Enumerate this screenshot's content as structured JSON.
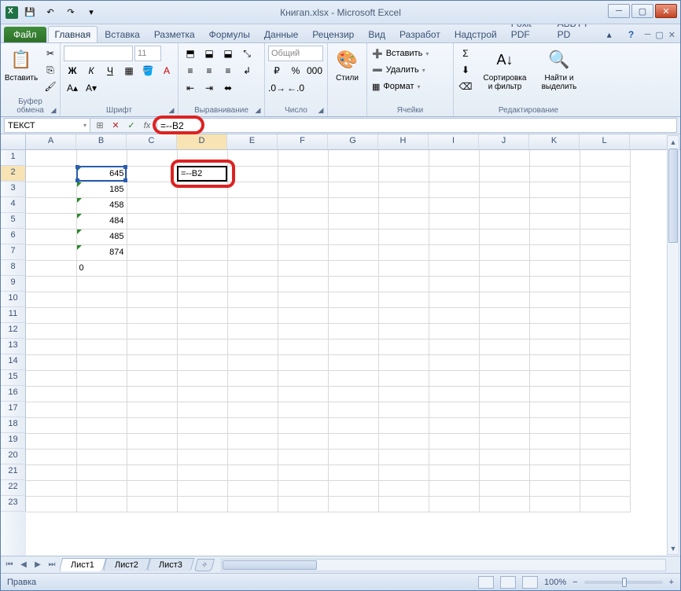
{
  "window": {
    "title": "Книгаn.xlsx - Microsoft Excel"
  },
  "qat": {
    "save": "💾",
    "undo": "↶",
    "redo": "↷"
  },
  "tabs": {
    "file": "Файл",
    "items": [
      "Главная",
      "Вставка",
      "Разметка",
      "Формулы",
      "Данные",
      "Рецензир",
      "Вид",
      "Разработ",
      "Надстрой",
      "Foxit PDF",
      "ABBYY PD"
    ],
    "active_index": 0
  },
  "ribbon": {
    "clipboard": {
      "paste": "Вставить",
      "label": "Буфер обмена"
    },
    "font": {
      "name": "",
      "size": "11",
      "label": "Шрифт"
    },
    "alignment": {
      "label": "Выравнивание"
    },
    "number": {
      "format": "Общий",
      "label": "Число"
    },
    "styles": {
      "btn": "Стили",
      "label": ""
    },
    "cells": {
      "insert": "Вставить",
      "delete": "Удалить",
      "format": "Формат",
      "label": "Ячейки"
    },
    "editing": {
      "sort": "Сортировка\nи фильтр",
      "find": "Найти и\nвыделить",
      "label": "Редактирование"
    }
  },
  "formula": {
    "name_box": "ТЕКСТ",
    "value": "=--B2"
  },
  "grid": {
    "columns": [
      "A",
      "B",
      "C",
      "D",
      "E",
      "F",
      "G",
      "H",
      "I",
      "J",
      "K",
      "L"
    ],
    "rows": 23,
    "active": {
      "col": 3,
      "row": 1,
      "display": "=--B2"
    },
    "ref_range": {
      "col": 1,
      "row": 1
    },
    "data_b": [
      "645",
      "185",
      "458",
      "484",
      "485",
      "874"
    ],
    "b8": "0"
  },
  "sheets": {
    "items": [
      "Лист1",
      "Лист2",
      "Лист3"
    ],
    "active_index": 0
  },
  "status": {
    "mode": "Правка",
    "zoom": "100%"
  }
}
